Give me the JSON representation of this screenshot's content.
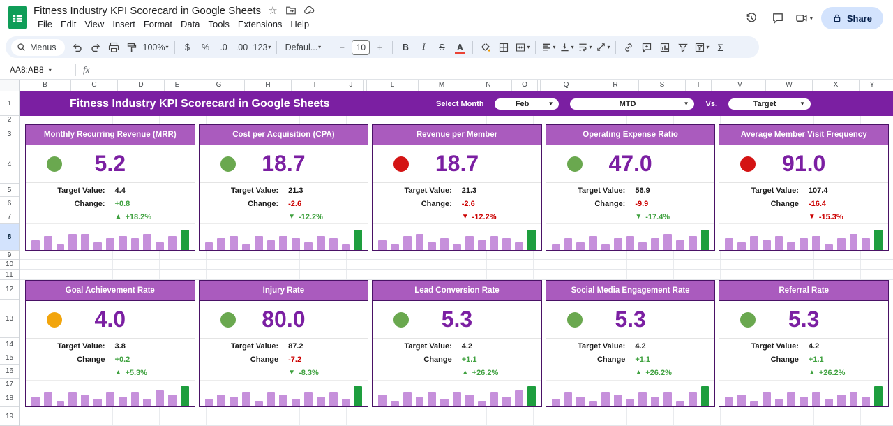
{
  "titlebar": {
    "doc_title": "Fitness Industry KPI Scorecard in Google Sheets",
    "menus": [
      "File",
      "Edit",
      "View",
      "Insert",
      "Format",
      "Data",
      "Tools",
      "Extensions",
      "Help"
    ],
    "share_label": "Share"
  },
  "toolbar": {
    "menus_label": "Menus",
    "zoom_value": "100%",
    "currency": "$",
    "percent": "%",
    "decrease_decimal": ".0",
    "increase_decimal": ".00",
    "more_formats": "123",
    "font_name": "Defaul...",
    "decrease_size": "−",
    "font_size": "10",
    "increase_size": "+",
    "bold": "B",
    "italic": "I",
    "strikethrough": "S",
    "text_color": "A",
    "functions": "Σ"
  },
  "formula_bar": {
    "name_box": "AA8:AB8",
    "fx_label": "fx"
  },
  "grid": {
    "columns": [
      "B",
      "C",
      "D",
      "E",
      "G",
      "H",
      "I",
      "J",
      "L",
      "M",
      "N",
      "O",
      "Q",
      "R",
      "S",
      "T",
      "V",
      "W",
      "X",
      "Y"
    ],
    "rows": [
      "1",
      "2",
      "3",
      "4",
      "5",
      "6",
      "7",
      "8",
      "9",
      "10",
      "11",
      "12",
      "13",
      "14",
      "15",
      "16",
      "17",
      "18",
      "19"
    ],
    "selected_row": "8"
  },
  "banner": {
    "title": "Fitness Industry KPI Scorecard in Google Sheets",
    "select_month_label": "Select Month",
    "month_value": "Feb",
    "period_value": "MTD",
    "vs_label": "Vs.",
    "compare_value": "Target"
  },
  "colors": {
    "purple_deep": "#7B1FA2",
    "purple_header": "#AA5BBE",
    "purple_value": "#7B1FA2",
    "card_border": "#4A1266",
    "dot_green": "#6AA84F",
    "dot_red": "#D41414",
    "dot_amber": "#F2A50C",
    "text_green": "#3FA13F",
    "text_red": "#CC0000",
    "bar_purple": "#C690DB",
    "bar_green": "#1E9E3E",
    "share_bg": "#D3E3FD",
    "share_text": "#041E49",
    "toolbar_bg": "#EDF2FA",
    "selected_header_bg": "#D3E3FD"
  },
  "cards_row1": [
    {
      "title": "Monthly Recurring Revenue (MRR)",
      "status_color": "green",
      "value": "5.2",
      "target_label": "Target Value:",
      "target_value": "4.4",
      "change_label": "Change:",
      "change_value": "+0.8",
      "change_tone": "pos",
      "trend_dir": "up",
      "trend_value": "+18.2%",
      "trend_tone": "pos",
      "spark": {
        "values": [
          4,
          6,
          2,
          7,
          7,
          3,
          5,
          6,
          5,
          7,
          3,
          6,
          9
        ]
      }
    },
    {
      "title": "Cost per Acquisition (CPA)",
      "status_color": "green",
      "value": "18.7",
      "target_label": "Target Value:",
      "target_value": "21.3",
      "change_label": "Change:",
      "change_value": "-2.6",
      "change_tone": "neg",
      "trend_dir": "down",
      "trend_value": "-12.2%",
      "trend_tone": "pos",
      "spark": {
        "values": [
          3,
          5,
          6,
          2,
          6,
          4,
          6,
          5,
          3,
          6,
          5,
          2,
          9
        ]
      }
    },
    {
      "title": "Revenue per Member",
      "status_color": "red",
      "value": "18.7",
      "target_label": "Target Value:",
      "target_value": "21.3",
      "change_label": "Change:",
      "change_value": "-2.6",
      "change_tone": "neg",
      "trend_dir": "down",
      "trend_value": "-12.2%",
      "trend_tone": "neg",
      "spark": {
        "values": [
          4,
          2,
          6,
          7,
          3,
          5,
          2,
          6,
          4,
          6,
          5,
          3,
          9
        ]
      }
    },
    {
      "title": "Operating Expense Ratio",
      "status_color": "green",
      "value": "47.0",
      "target_label": "Target Value:",
      "target_value": "56.9",
      "change_label": "Change:",
      "change_value": "-9.9",
      "change_tone": "neg",
      "trend_dir": "down",
      "trend_value": "-17.4%",
      "trend_tone": "pos",
      "spark": {
        "values": [
          2,
          5,
          3,
          6,
          2,
          5,
          6,
          3,
          5,
          7,
          4,
          6,
          9
        ]
      }
    },
    {
      "title": "Average Member Visit Frequency",
      "status_color": "red",
      "value": "91.0",
      "target_label": "Target Value:",
      "target_value": "107.4",
      "change_label": "Change",
      "change_value": "-16.4",
      "change_tone": "neg",
      "trend_dir": "down",
      "trend_value": "-15.3%",
      "trend_tone": "neg",
      "spark": {
        "values": [
          5,
          3,
          6,
          4,
          6,
          3,
          5,
          6,
          2,
          5,
          7,
          5,
          9
        ]
      }
    }
  ],
  "cards_row2": [
    {
      "title": "Goal Achievement Rate",
      "status_color": "amber",
      "value": "4.0",
      "target_label": "Target Value:",
      "target_value": "3.8",
      "change_label": "Change",
      "change_value": "+0.2",
      "change_tone": "pos",
      "trend_dir": "up",
      "trend_value": "+5.3%",
      "trend_tone": "pos",
      "spark": {
        "values": [
          4,
          6,
          2,
          6,
          5,
          3,
          6,
          4,
          6,
          3,
          7,
          5,
          9
        ]
      }
    },
    {
      "title": "Injury Rate",
      "status_color": "green",
      "value": "80.0",
      "target_label": "Target Value:",
      "target_value": "87.2",
      "change_label": "Change",
      "change_value": "-7.2",
      "change_tone": "neg",
      "trend_dir": "down",
      "trend_value": "-8.3%",
      "trend_tone": "pos",
      "spark": {
        "values": [
          3,
          5,
          4,
          6,
          2,
          6,
          5,
          3,
          6,
          4,
          6,
          3,
          9
        ]
      }
    },
    {
      "title": "Lead Conversion Rate",
      "status_color": "green",
      "value": "5.3",
      "target_label": "Target Value:",
      "target_value": "4.2",
      "change_label": "Change",
      "change_value": "+1.1",
      "change_tone": "pos",
      "trend_dir": "up",
      "trend_value": "+26.2%",
      "trend_tone": "pos",
      "spark": {
        "values": [
          5,
          2,
          6,
          4,
          6,
          3,
          6,
          5,
          2,
          6,
          4,
          7,
          9
        ]
      }
    },
    {
      "title": "Social Media Engagement Rate",
      "status_color": "green",
      "value": "5.3",
      "target_label": "Target Value:",
      "target_value": "4.2",
      "change_label": "Change",
      "change_value": "+1.1",
      "change_tone": "pos",
      "trend_dir": "up",
      "trend_value": "+26.2%",
      "trend_tone": "pos",
      "spark": {
        "values": [
          3,
          6,
          4,
          2,
          6,
          5,
          3,
          6,
          4,
          6,
          2,
          6,
          9
        ]
      }
    },
    {
      "title": "Referral Rate",
      "status_color": "green",
      "value": "5.3",
      "target_label": "Target Value:",
      "target_value": "4.2",
      "change_label": "Change",
      "change_value": "+1.1",
      "change_tone": "pos",
      "trend_dir": "up",
      "trend_value": "+26.2%",
      "trend_tone": "pos",
      "spark": {
        "values": [
          4,
          5,
          2,
          6,
          3,
          6,
          4,
          6,
          3,
          5,
          6,
          4,
          9
        ]
      }
    }
  ]
}
